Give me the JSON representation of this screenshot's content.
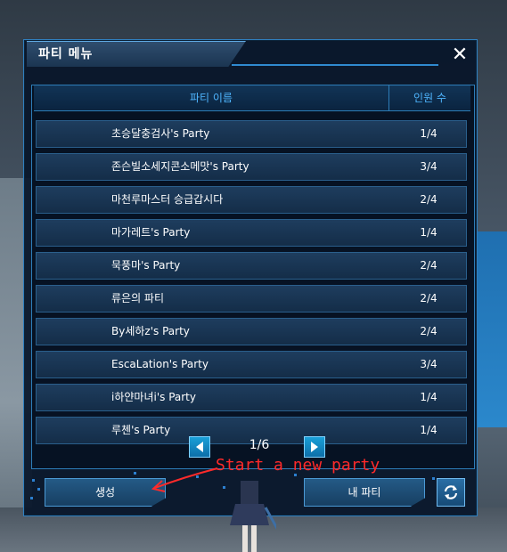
{
  "window": {
    "title": "파티 메뉴",
    "close_label": "✕"
  },
  "table": {
    "headers": {
      "name": "파티 이름",
      "count": "인원 수"
    },
    "rows": [
      {
        "name": "초승달충검사's Party",
        "count": "1/4"
      },
      {
        "name": "존슨빌소세지콘소메맛's Party",
        "count": "3/4"
      },
      {
        "name": "마천루마스터 승급갑시다",
        "count": "2/4"
      },
      {
        "name": "마가레트's Party",
        "count": "1/4"
      },
      {
        "name": "묵풍마's Party",
        "count": "2/4"
      },
      {
        "name": "류은의 파티",
        "count": "2/4"
      },
      {
        "name": "By세하z's Party",
        "count": "2/4"
      },
      {
        "name": "EscaLation's Party",
        "count": "3/4"
      },
      {
        "name": "i하얀마녀i's Party",
        "count": "1/4"
      },
      {
        "name": "루첸's Party",
        "count": "1/4"
      }
    ]
  },
  "pager": {
    "text": "1/6",
    "prev_icon": "triangle-left-icon",
    "next_icon": "triangle-right-icon"
  },
  "buttons": {
    "create_label": "생성",
    "my_party_label": "내 파티",
    "refresh_icon": "refresh-icon"
  },
  "annotation": {
    "text": "Start a new party",
    "color": "#ff2a2a"
  },
  "colors": {
    "accent": "#4fb6ff",
    "panel": "#08162a",
    "border": "#2f7fbf"
  }
}
